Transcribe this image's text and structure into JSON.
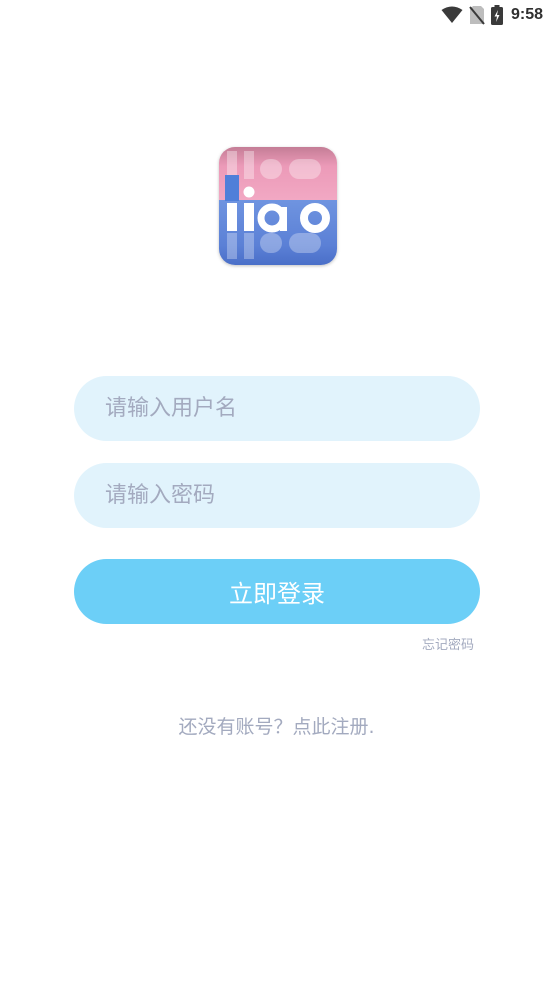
{
  "status_bar": {
    "time": "9:58",
    "icons": [
      "wifi-icon",
      "no-sim-icon",
      "battery-charging-icon"
    ]
  },
  "logo": {
    "text": "liao",
    "colors": {
      "top": "#e88fb0",
      "bottom": "#5a7fd6",
      "letter": "#ffffff"
    }
  },
  "login_form": {
    "username_placeholder": "请输入用户名",
    "username_value": "",
    "password_placeholder": "请输入密码",
    "password_value": "",
    "login_label": "立即登录",
    "forgot_label": "忘记密码"
  },
  "register": {
    "label": "还没有账号？点此注册."
  },
  "colors": {
    "background": "#ffffff",
    "field_bg": "#e1f3fc",
    "button_bg": "#6ccff7",
    "button_text": "#ffffff",
    "muted_text": "#a3aabf"
  }
}
